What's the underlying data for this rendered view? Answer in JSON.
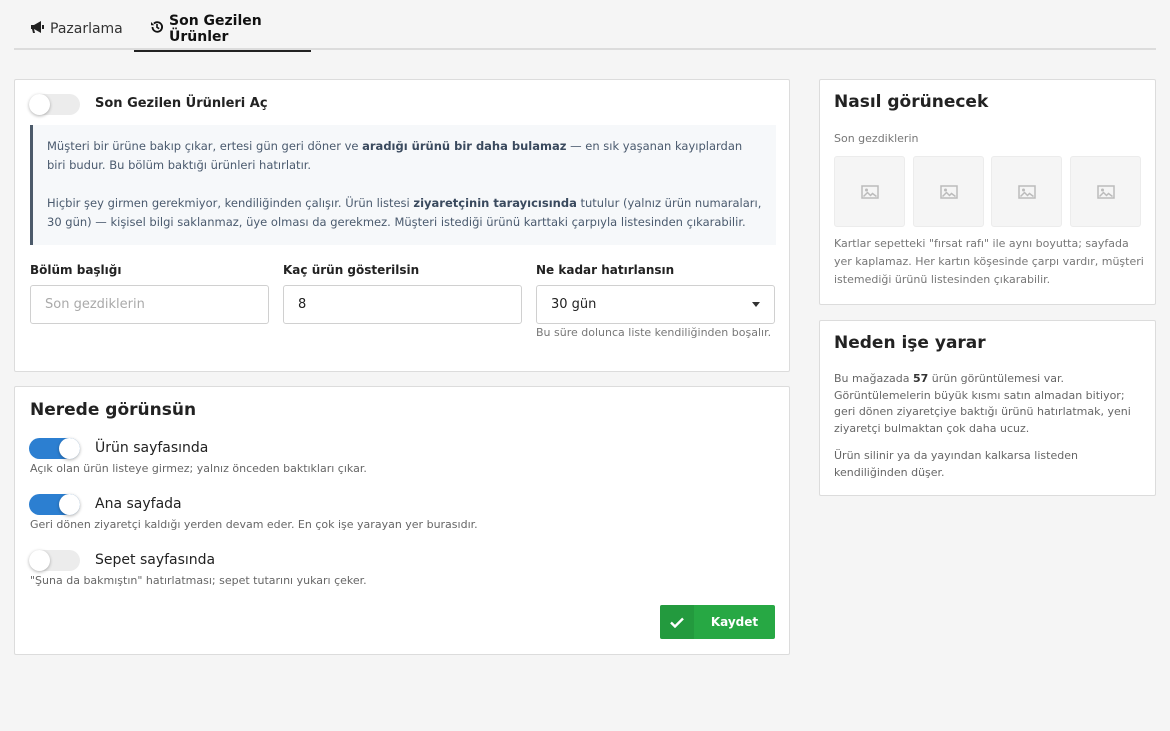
{
  "tabs": [
    {
      "label": "Pazarlama",
      "icon": "megaphone-icon"
    },
    {
      "label": "Son Gezilen Ürünler",
      "icon": "history-icon"
    }
  ],
  "main": {
    "toggle_label": "Son Gezilen Ürünleri Aç",
    "toggle_on": false,
    "info_p1_pre": "Müşteri bir ürüne bakıp çıkar, ertesi gün geri döner ve ",
    "info_p1_bold": "aradığı ürünü bir daha bulamaz",
    "info_p1_post": " — en sık yaşanan kayıplardan biri budur. Bu bölüm baktığı ürünleri hatırlatır.",
    "info_p2_pre": "Hiçbir şey girmen gerekmiyor, kendiliğinden çalışır. Ürün listesi ",
    "info_p2_bold": "ziyaretçinin tarayıcısında",
    "info_p2_post": " tutulur (yalnız ürün numaraları, 30 gün) — kişisel bilgi saklanmaz, üye olması da gerekmez. Müşteri istediği ürünü karttaki çarpıyla listesinden çıkarabilir.",
    "fields": {
      "title_label": "Bölüm başlığı",
      "title_placeholder": "Son gezdiklerin",
      "title_value": "",
      "count_label": "Kaç ürün gösterilsin",
      "count_value": "8",
      "duration_label": "Ne kadar hatırlansın",
      "duration_value": "30 gün",
      "duration_help": "Bu süre dolunca liste kendiliğinden boşalır."
    }
  },
  "where": {
    "title": "Nerede görünsün",
    "options": [
      {
        "label": "Ürün sayfasında",
        "desc": "Açık olan ürün listeye girmez; yalnız önceden baktıkları çıkar.",
        "on": true
      },
      {
        "label": "Ana sayfada",
        "desc": "Geri dönen ziyaretçi kaldığı yerden devam eder. En çok işe yarayan yer burasıdır.",
        "on": true
      },
      {
        "label": "Sepet sayfasında",
        "desc": "\"Şuna da bakmıştın\" hatırlatması; sepet tutarını yukarı çeker.",
        "on": false
      }
    ],
    "save_label": "Kaydet"
  },
  "how": {
    "title": "Nasıl görünecek",
    "subtitle": "Son gezdiklerin",
    "placeholder_count": 4,
    "note": "Kartlar sepetteki \"fırsat rafı\" ile aynı boyutta; sayfada yer kaplamaz. Her kartın köşesinde çarpı vardır, müşteri istemediği ürünü listesinden çıkarabilir."
  },
  "why": {
    "title": "Neden işe yarar",
    "p1_pre": "Bu mağazada ",
    "p1_count": "57",
    "p1_post": " ürün görüntülemesi var. Görüntülemelerin büyük kısmı satın almadan bitiyor; geri dönen ziyaretçiye baktığı ürünü hatırlatmak, yeni ziyaretçi bulmaktan çok daha ucuz.",
    "p2": "Ürün silinir ya da yayından kalkarsa listeden kendiliğinden düşer."
  },
  "colors": {
    "accent": "#2c7fd1",
    "save": "#27a844",
    "info_border": "#4c5a6a"
  }
}
